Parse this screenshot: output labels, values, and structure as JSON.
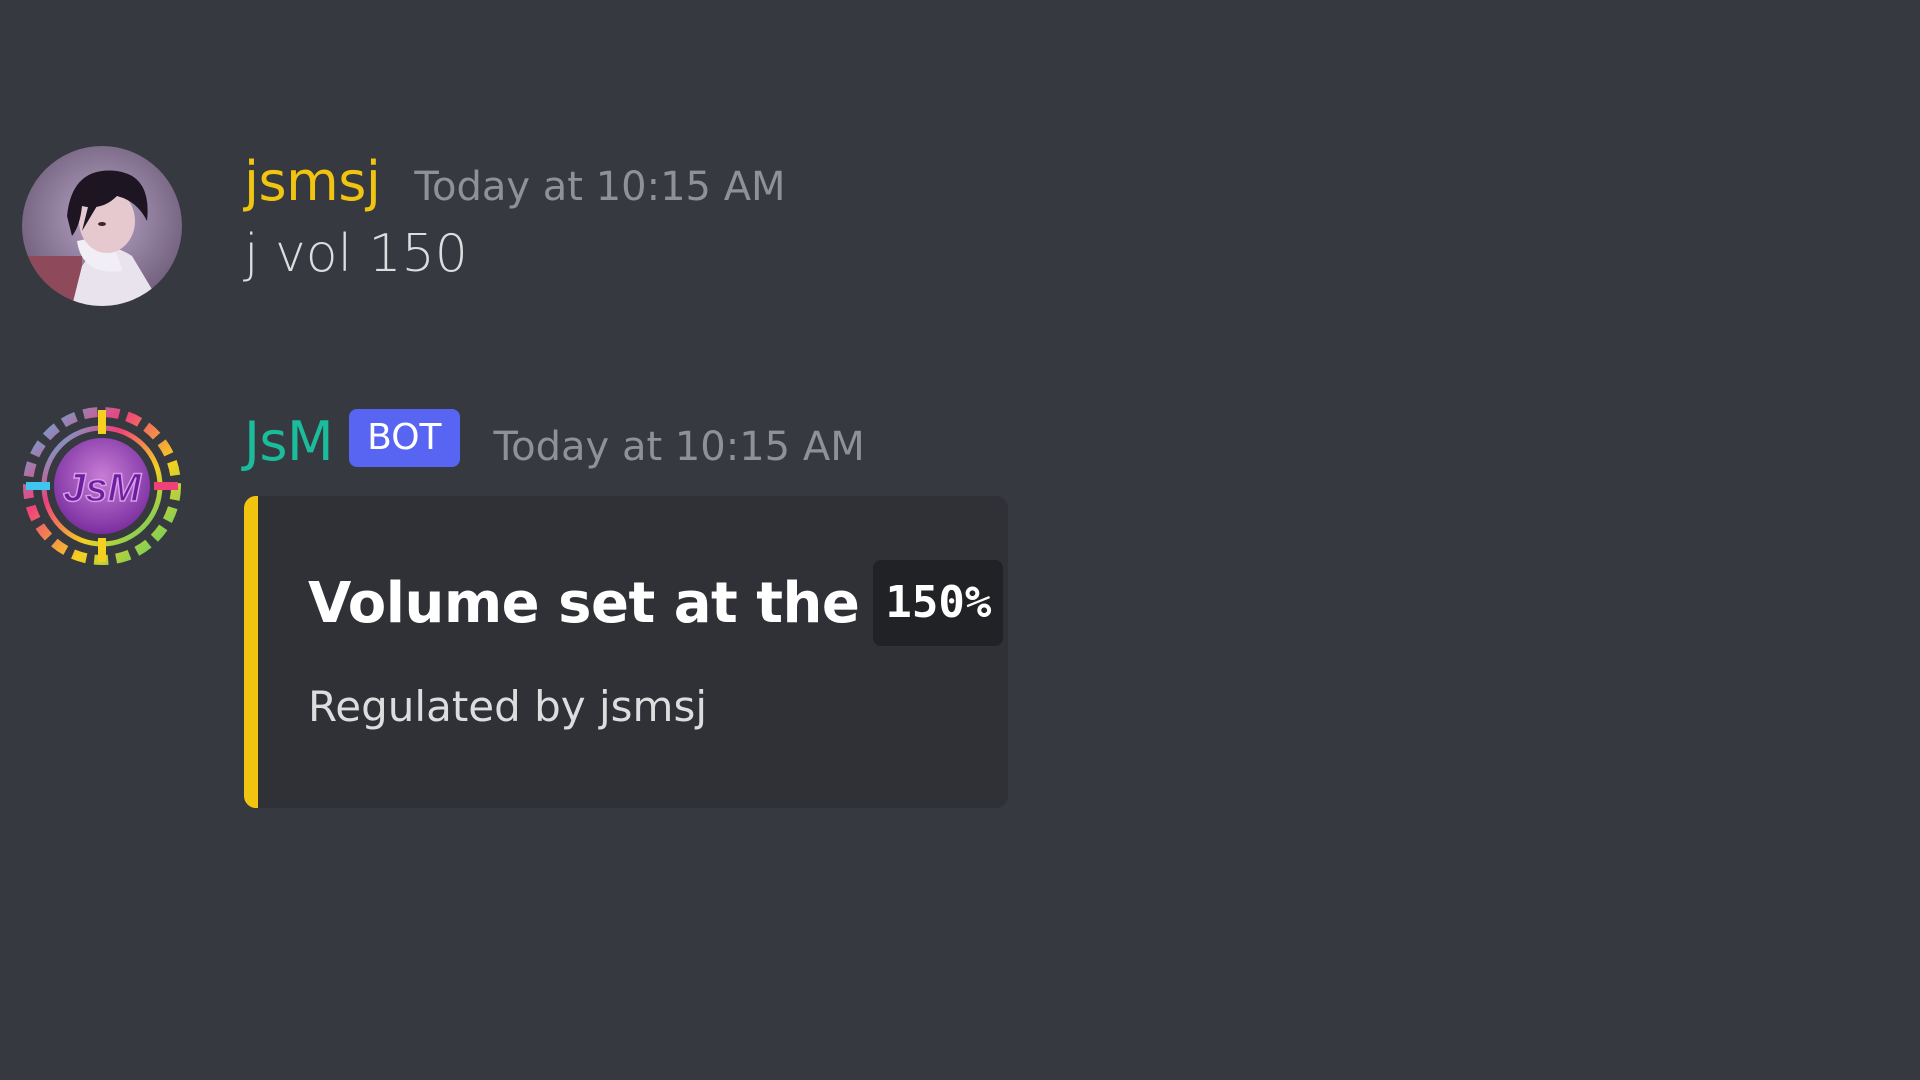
{
  "messages": {
    "user_message": {
      "avatar_icon": "anime-avatar-icon",
      "username": "jsmsj",
      "username_color": "#f1c40f",
      "timestamp": "Today at 10:15 AM",
      "text": "j vol 150"
    },
    "bot_message": {
      "avatar_icon": "jsm-logo-icon",
      "avatar_text": "JsM",
      "username": "JsM",
      "username_color": "#1abc9c",
      "bot_tag": "BOT",
      "bot_tag_color": "#5865f2",
      "timestamp": "Today at 10:15 AM",
      "embed": {
        "accent_color": "#f1c40f",
        "title": "Volume set at the",
        "title_code": "150%",
        "description": "Regulated by jsmsj"
      }
    }
  },
  "colors": {
    "background": "#36393f",
    "embed_background": "#2f3136",
    "timestamp": "#8e9297",
    "text": "#dcddde"
  }
}
